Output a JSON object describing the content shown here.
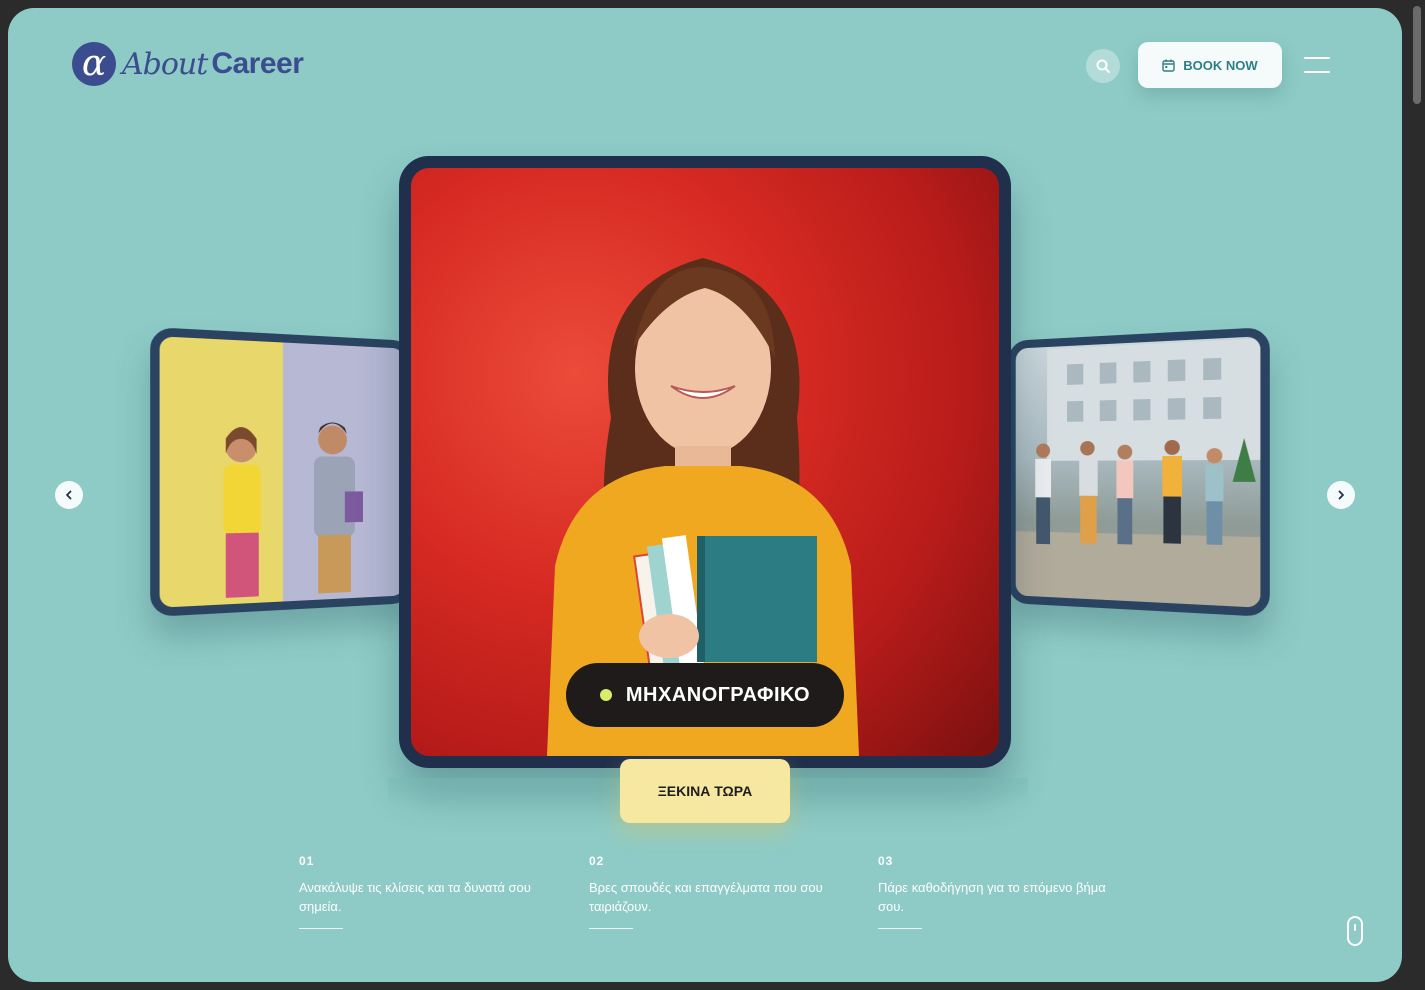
{
  "header": {
    "logo_mark": "α",
    "logo_about": "About",
    "logo_career": "Career",
    "book_label": "BOOK NOW"
  },
  "icons": {
    "search": "search-icon",
    "calendar": "calendar-icon",
    "menu": "hamburger-icon",
    "prev": "chevron-left-icon",
    "next": "chevron-right-icon",
    "scroll": "mouse-scroll-icon"
  },
  "slider": {
    "active_label": "ΜΗΧΑΝΟΓΡΑΦΙΚΟ",
    "cta_label": "ΞΕΚΙΝΑ ΤΩΡΑ"
  },
  "steps": [
    {
      "num": "01",
      "text": "Ανακάλυψε τις κλίσεις και τα δυνατά σου σημεία."
    },
    {
      "num": "02",
      "text": "Βρες σπουδές και επαγγέλματα που σου ταιριάζουν."
    },
    {
      "num": "03",
      "text": "Πάρε καθοδήγηση για το επόμενο βήμα σου."
    }
  ],
  "colors": {
    "background": "#8ecbc6",
    "brand": "#3b4c8f",
    "card_border": "#1f2f4c",
    "cta": "#f6e7a1",
    "label_dot": "#d8ee6a"
  }
}
